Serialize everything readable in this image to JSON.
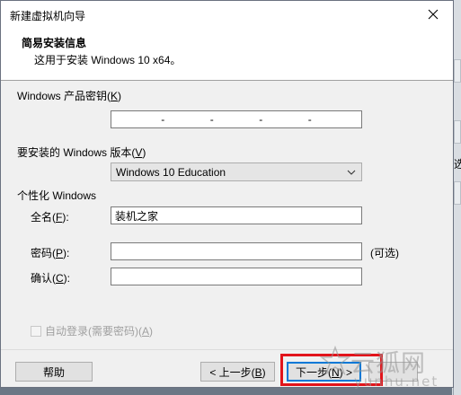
{
  "window": {
    "title": "新建虚拟机向导"
  },
  "header": {
    "title": "简易安装信息",
    "subtitle": "这用于安装 Windows 10 x64。"
  },
  "product_key": {
    "label_prefix": "Windows 产品密钥(",
    "label_key": "K",
    "label_suffix": ")",
    "separators": [
      "-",
      "-",
      "-",
      "-"
    ]
  },
  "version": {
    "label_prefix": "要安装的 Windows 版本(",
    "label_key": "V",
    "label_suffix": ")",
    "selected": "Windows 10 Education"
  },
  "personalize": {
    "section_label": "个性化 Windows",
    "fullname": {
      "label_prefix": "全名(",
      "label_key": "F",
      "label_suffix": "):",
      "value": "装机之家"
    },
    "password": {
      "label_prefix": "密码(",
      "label_key": "P",
      "label_suffix": "):",
      "value": "",
      "hint": "(可选)"
    },
    "confirm": {
      "label_prefix": "确认(",
      "label_key": "C",
      "label_suffix": "):",
      "value": ""
    }
  },
  "autologin": {
    "label_prefix": "自动登录(需要密码)(",
    "label_key": "A",
    "label_suffix": ")",
    "checked": false,
    "enabled": false
  },
  "buttons": {
    "help": "帮助",
    "back_prefix": "< 上一步(",
    "back_key": "B",
    "back_suffix": ")",
    "next_prefix": "下一步(",
    "next_key": "N",
    "next_suffix": ") >"
  },
  "background": {
    "partial_text": "选"
  },
  "watermark": {
    "big": "云狐网",
    "small": "yunhu.net"
  },
  "colors": {
    "highlight": "#e2141b",
    "focus": "#0078d7",
    "dialog_bg": "#f0f0f0"
  }
}
